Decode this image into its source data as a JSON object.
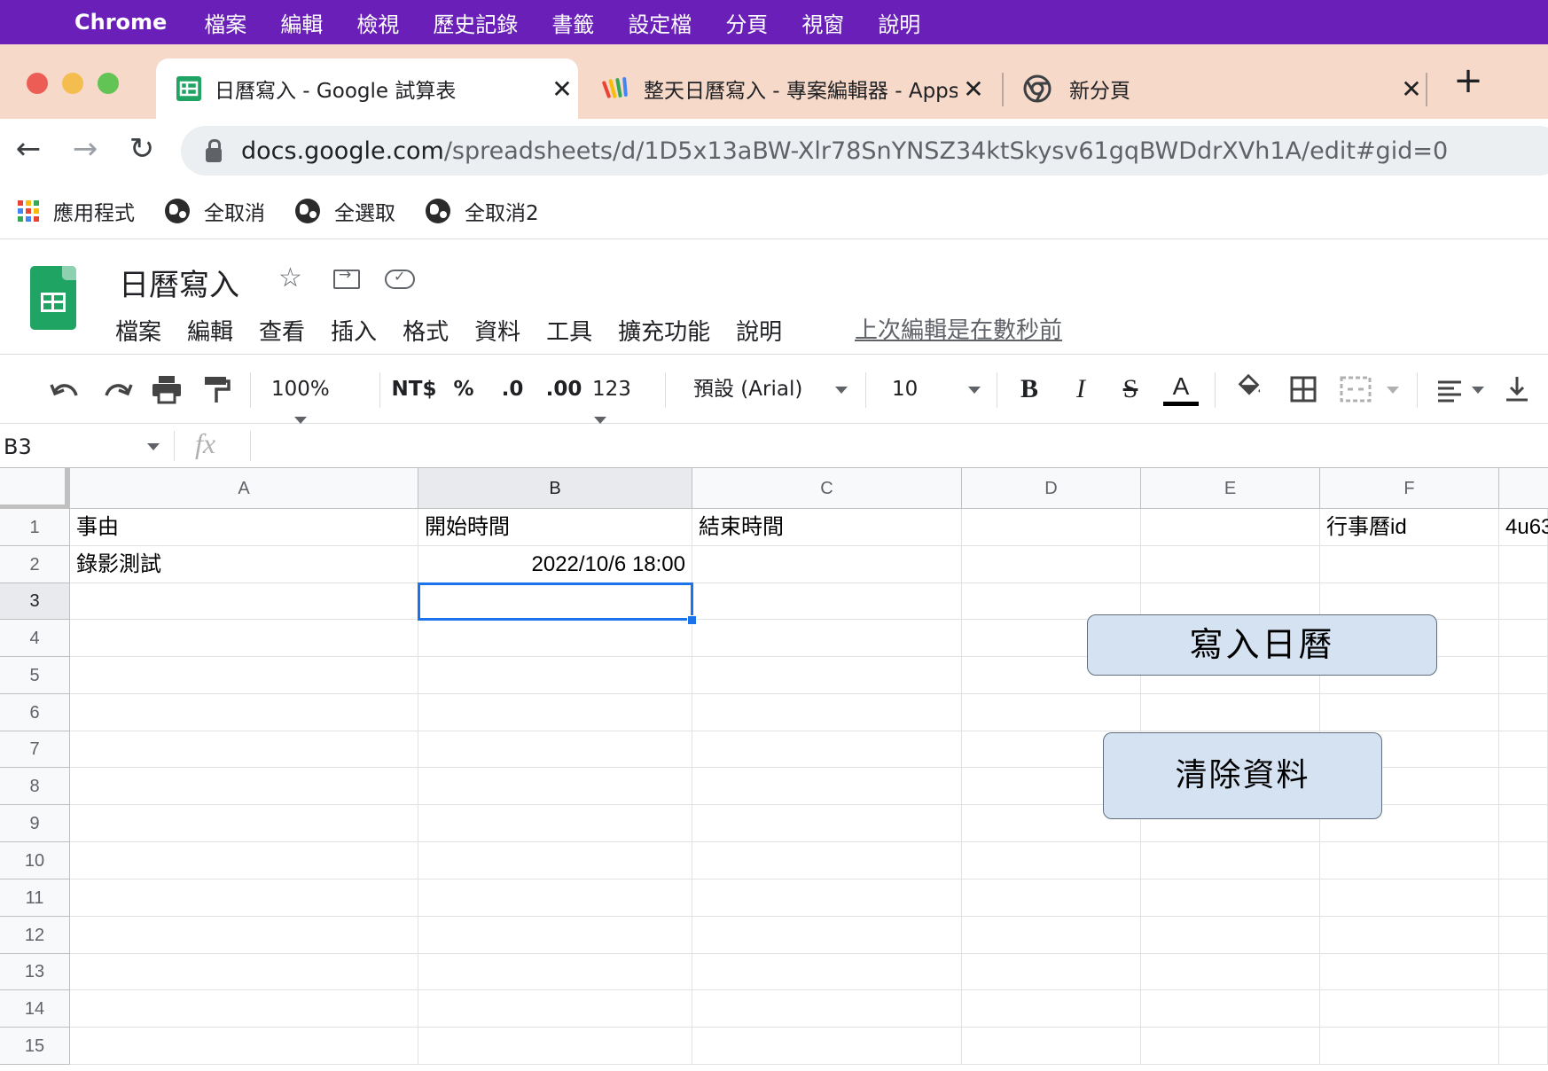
{
  "mac_menu": {
    "app": "Chrome",
    "items": [
      "檔案",
      "編輯",
      "檢視",
      "歷史記錄",
      "書籤",
      "設定檔",
      "分頁",
      "視窗",
      "說明"
    ]
  },
  "tabs": [
    {
      "title": "日曆寫入 - Google 試算表"
    },
    {
      "title": "整天日曆寫入 - 專案編輯器 - Apps Script"
    },
    {
      "title": "新分頁"
    }
  ],
  "address": {
    "host": "docs.google.com",
    "path": "/spreadsheets/d/1D5x13aBW-Xlr78SnYNSZ34ktSkysv61gqBWDdrXVh1A/edit#gid=0"
  },
  "bookmarks": [
    "應用程式",
    "全取消",
    "全選取",
    "全取消2"
  ],
  "sheet": {
    "title": "日曆寫入",
    "menu": [
      "檔案",
      "編輯",
      "查看",
      "插入",
      "格式",
      "資料",
      "工具",
      "擴充功能",
      "說明"
    ],
    "last_edit": "上次編輯是在數秒前"
  },
  "toolbar": {
    "zoom": "100%",
    "currency": "NT$",
    "percent": "%",
    "dec_less": ".0",
    "dec_more": ".00",
    "format_more": "123",
    "font": "預設 (Arial)",
    "font_size": "10",
    "bold": "B",
    "italic": "I",
    "strike": "S",
    "text_color": "A"
  },
  "formula_bar": {
    "cell_ref": "B3",
    "fx": "fx",
    "value": ""
  },
  "grid": {
    "columns": [
      "A",
      "B",
      "C",
      "D",
      "E",
      "F"
    ],
    "rows": [
      "1",
      "2",
      "3",
      "4",
      "5",
      "6",
      "7",
      "8",
      "9",
      "10",
      "11",
      "12",
      "13",
      "14",
      "15"
    ],
    "cells": {
      "A1": "事由",
      "B1": "開始時間",
      "C1": "結束時間",
      "F1": "行事曆id",
      "G1": "4u63",
      "A2": "錄影測試",
      "B2": "2022/10/6 18:00"
    },
    "selected_cell": "B3"
  },
  "drawings": {
    "write_calendar": "寫入日曆",
    "clear_data": "清除資料"
  },
  "colors": {
    "mac_menubar": "#6a1fb8",
    "tabstrip": "#f6d9c9",
    "selection": "#1a73e8",
    "drawing_fill": "#d5e2f1",
    "sheets_green": "#1fa463"
  }
}
